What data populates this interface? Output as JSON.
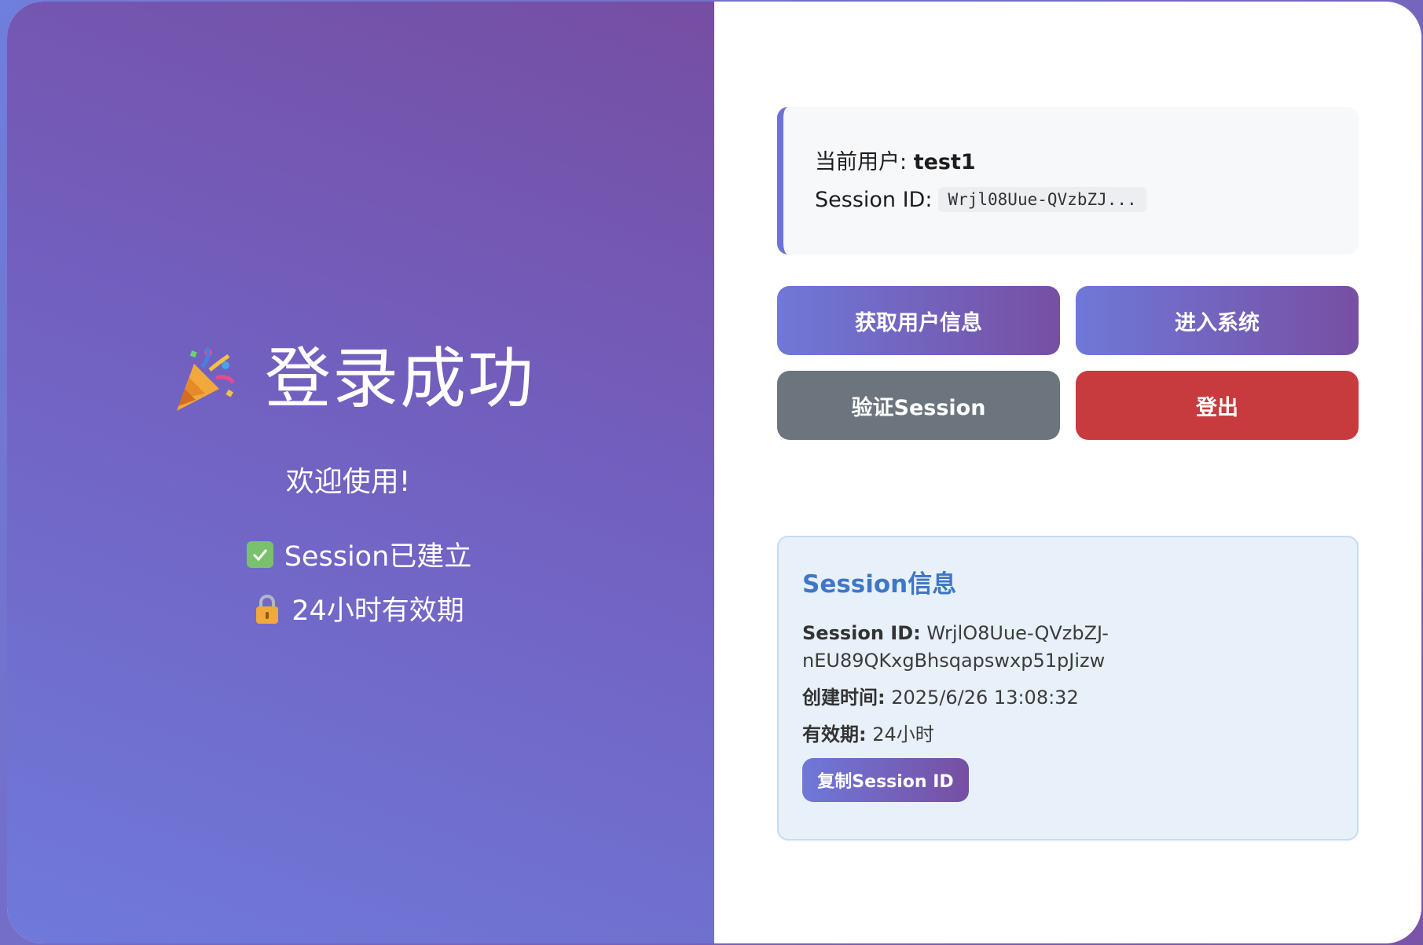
{
  "left": {
    "title": "登录成功",
    "title_icon": "party-popper-icon",
    "welcome": "欢迎使用!",
    "features": [
      {
        "icon": "check-box-icon",
        "label": "Session已建立"
      },
      {
        "icon": "lock-icon",
        "label": "24小时有效期"
      }
    ]
  },
  "user_box": {
    "user_label": "当前用户: ",
    "username": "test1",
    "session_label": "Session ID:",
    "session_short": "Wrjl08Uue-QVzbZJ..."
  },
  "buttons": {
    "get_user_info": "获取用户信息",
    "enter_system": "进入系统",
    "verify_session": "验证Session",
    "logout": "登出"
  },
  "session_info": {
    "title": "Session信息",
    "id_label": "Session ID:",
    "id_value": " WrjlO8Uue-QVzbZJ-nEU89QKxgBhsqapswxp51pJizw",
    "created_label": "创建时间:",
    "created_value": " 2025/6/26 13:08:32",
    "validity_label": "有效期:",
    "validity_value": " 24小时",
    "copy_button": "复制Session ID"
  },
  "colors": {
    "accent_start": "#6f78d8",
    "accent_end": "#774fa3",
    "gray_button": "#6c757d",
    "red_button": "#c73b3f",
    "info_title": "#3f76c7",
    "info_bg": "#e8f1fa"
  }
}
